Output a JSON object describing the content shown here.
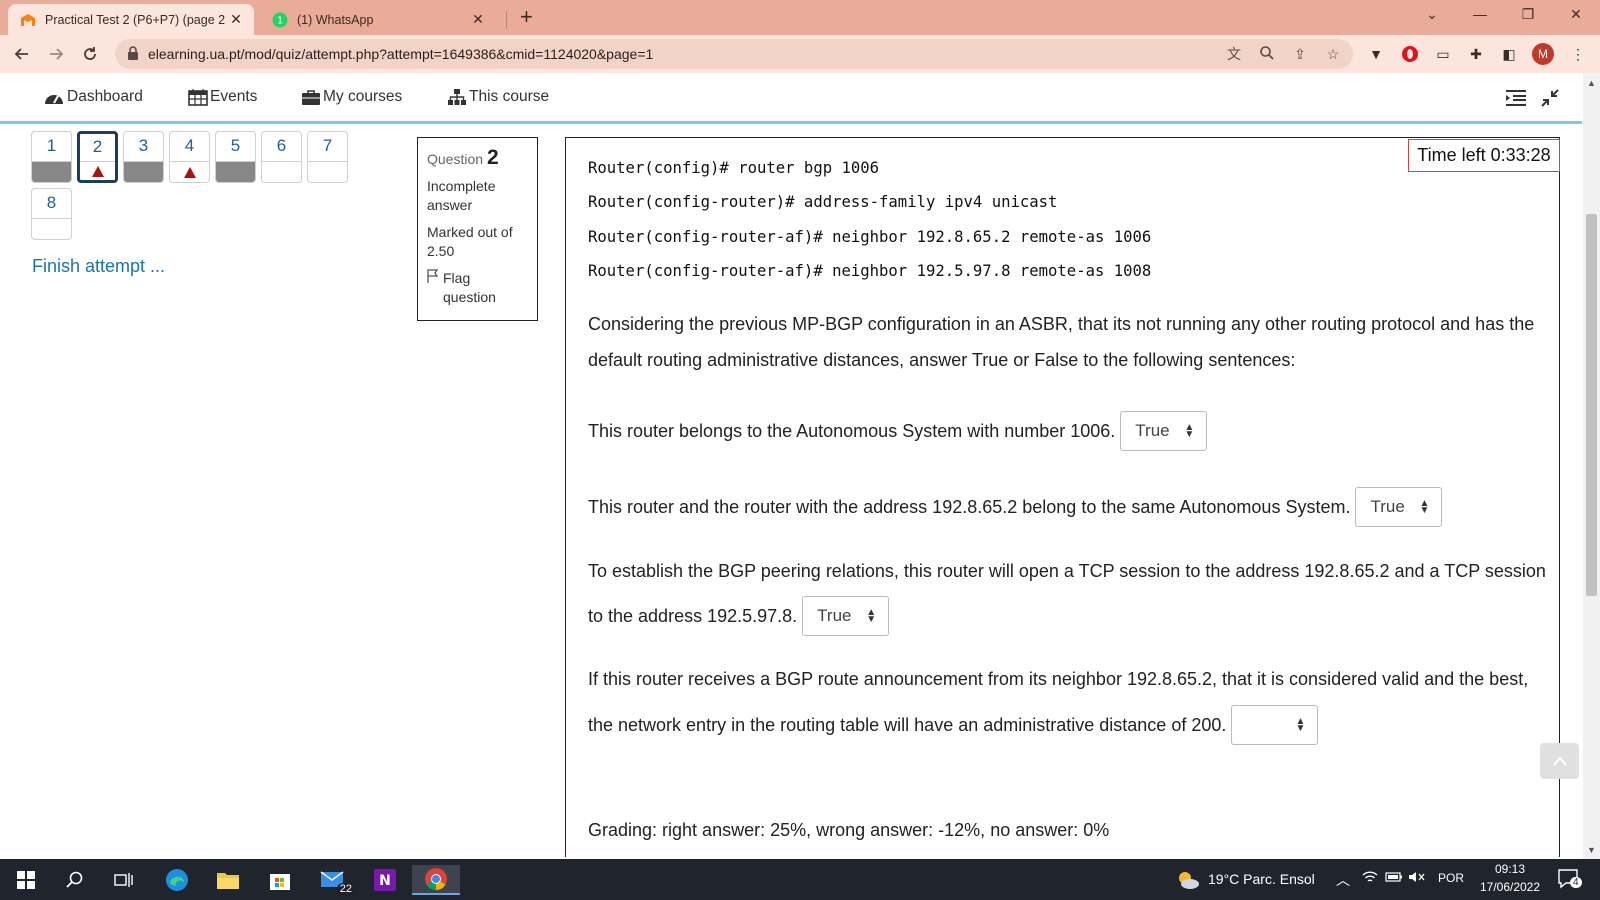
{
  "browser": {
    "tabs": [
      {
        "title": "Practical Test 2 (P6+P7) (page 2 o",
        "icon": "moodle-favicon"
      },
      {
        "title": "(1) WhatsApp",
        "icon": "whatsapp-favicon"
      }
    ],
    "url": "elearning.ua.pt/mod/quiz/attempt.php?attempt=1649386&cmid=1124020&page=1",
    "profile_initial": "M"
  },
  "nav": {
    "dashboard": "Dashboard",
    "events": "Events",
    "my_courses": "My courses",
    "this_course": "This course"
  },
  "quiz_nav": {
    "buttons": [
      {
        "num": "1",
        "state": "answered"
      },
      {
        "num": "2",
        "state": "flagged-current"
      },
      {
        "num": "3",
        "state": "answered"
      },
      {
        "num": "4",
        "state": "flagged"
      },
      {
        "num": "5",
        "state": "answered"
      },
      {
        "num": "6",
        "state": "unanswered"
      },
      {
        "num": "7",
        "state": "unanswered"
      },
      {
        "num": "8",
        "state": "unanswered"
      }
    ],
    "finish_label": "Finish attempt ..."
  },
  "question_info": {
    "label": "Question",
    "number": "2",
    "status": "Incomplete answer",
    "marked": "Marked out of 2.50",
    "flag": "Flag question"
  },
  "timer": "Time left 0:33:28",
  "question": {
    "code_lines": [
      "Router(config)# router bgp 1006",
      "Router(config-router)# address-family ipv4 unicast",
      "Router(config-router-af)# neighbor 192.8.65.2 remote-as 1006",
      "Router(config-router-af)# neighbor 192.5.97.8 remote-as 1008"
    ],
    "intro": "Considering the previous MP-BGP configuration in an ASBR, that its not running any other routing protocol and has the default routing administrative distances, answer True or False to the following sentences:",
    "statements": [
      {
        "text": "This router belongs to the Autonomous System with number 1006.",
        "answer": "True"
      },
      {
        "text": "This router and the router with the address 192.8.65.2 belong to the same Autonomous System.",
        "answer": "True"
      },
      {
        "text_line1": "To establish the BGP peering relations, this router will open a TCP session to the address 192.8.65.2 and a TCP session",
        "text_line2": "to the address 192.5.97.8.",
        "answer": "True"
      },
      {
        "text_line1": "If this router receives a BGP route announcement from its neighbor 192.8.65.2, that it is considered valid and the best,",
        "text_line2": "the network entry in the routing table will have an administrative distance of 200.",
        "answer": ""
      }
    ],
    "grading": "Grading: right answer: 25%, wrong answer: -12%, no answer: 0%"
  },
  "taskbar": {
    "mail_badge": "22",
    "weather": "19°C  Parc. Ensol",
    "language": "POR",
    "time": "09:13",
    "date": "17/06/2022",
    "notifications": "4"
  },
  "colors": {
    "tabstrip": "#e8ac98",
    "toolbar": "#fbe5dd",
    "nav_accent": "#7fc8e8",
    "link": "#1a73b5",
    "flag": "#aa1111",
    "taskbar": "#20242c"
  }
}
